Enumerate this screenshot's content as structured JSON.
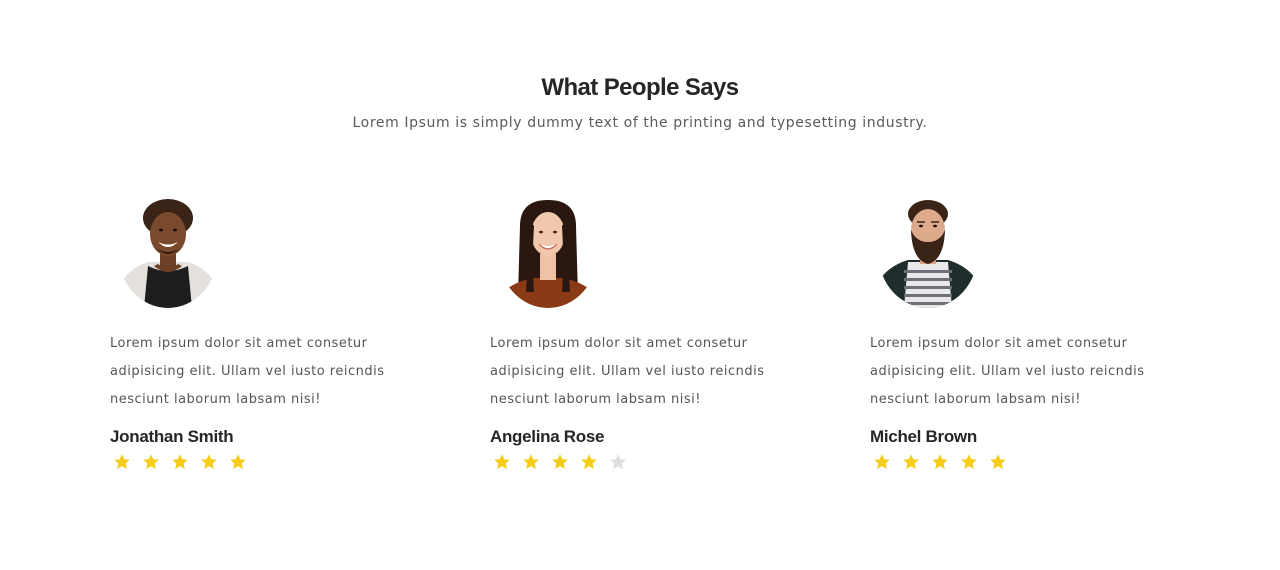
{
  "header": {
    "title": "What People Says",
    "subtitle": "Lorem Ipsum is simply dummy text of the printing and typesetting industry."
  },
  "colors": {
    "star_filled": "#f5cd19",
    "star_empty": "#dddddd",
    "heading": "#262626",
    "body_text": "#555555"
  },
  "testimonials": [
    {
      "avatar_icon": "avatar-photo-icon",
      "quote": "Lorem ipsum dolor sit amet consetur adipisicing elit. Ullam vel iusto reicndis nesciunt laborum labsam nisi!",
      "name": "Jonathan Smith",
      "rating": 5,
      "max_rating": 5
    },
    {
      "avatar_icon": "avatar-photo-icon",
      "quote": "Lorem ipsum dolor sit amet consetur adipisicing elit. Ullam vel iusto reicndis nesciunt laborum labsam nisi!",
      "name": "Angelina Rose",
      "rating": 4,
      "max_rating": 5
    },
    {
      "avatar_icon": "avatar-photo-icon",
      "quote": "Lorem ipsum dolor sit amet consetur adipisicing elit. Ullam vel iusto reicndis nesciunt laborum labsam nisi!",
      "name": "Michel Brown",
      "rating": 5,
      "max_rating": 5
    }
  ]
}
